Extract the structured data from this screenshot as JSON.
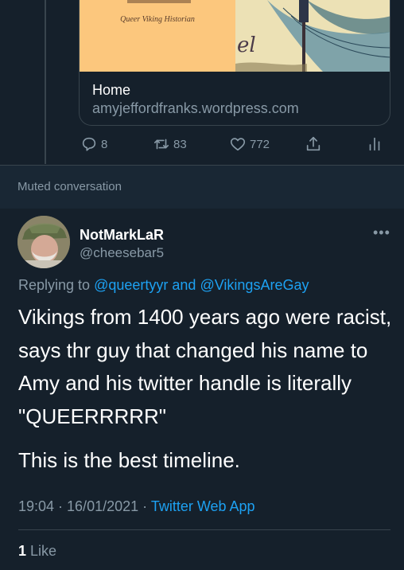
{
  "link_card": {
    "image_subtitle": "Queer Viking Historian",
    "image_script_text": "el",
    "title": "Home",
    "url": "amyjeffordfranks.wordpress.com"
  },
  "tweet_actions": {
    "reply_count": "8",
    "retweet_count": "83",
    "like_count": "772",
    "icons": [
      "reply-icon",
      "retweet-icon",
      "like-icon",
      "share-icon",
      "analytics-icon"
    ]
  },
  "muted_label": "Muted conversation",
  "tweet": {
    "author_name": "NotMarkLaR",
    "author_handle": "@cheesebar5",
    "more_label": "•••",
    "replying_prefix": "Replying to",
    "replying_mention_1": "@queertyyr",
    "replying_and": "and",
    "replying_mention_2": "@VikingsAreGay",
    "text_paragraph_1": "Vikings from 1400 years ago were racist, says thr guy that changed his name to Amy and his twitter handle is literally \"QUEERRRRR\"",
    "text_paragraph_2": "This is the best timeline.",
    "time": "19:04 · 16/01/2021 ·",
    "source": "Twitter Web App",
    "likes_count": "1",
    "likes_label": "Like"
  },
  "colors": {
    "background": "#15202b",
    "muted_background": "#192734",
    "accent": "#1da1f2",
    "secondary_text": "#8899a6",
    "border": "#38444d"
  }
}
